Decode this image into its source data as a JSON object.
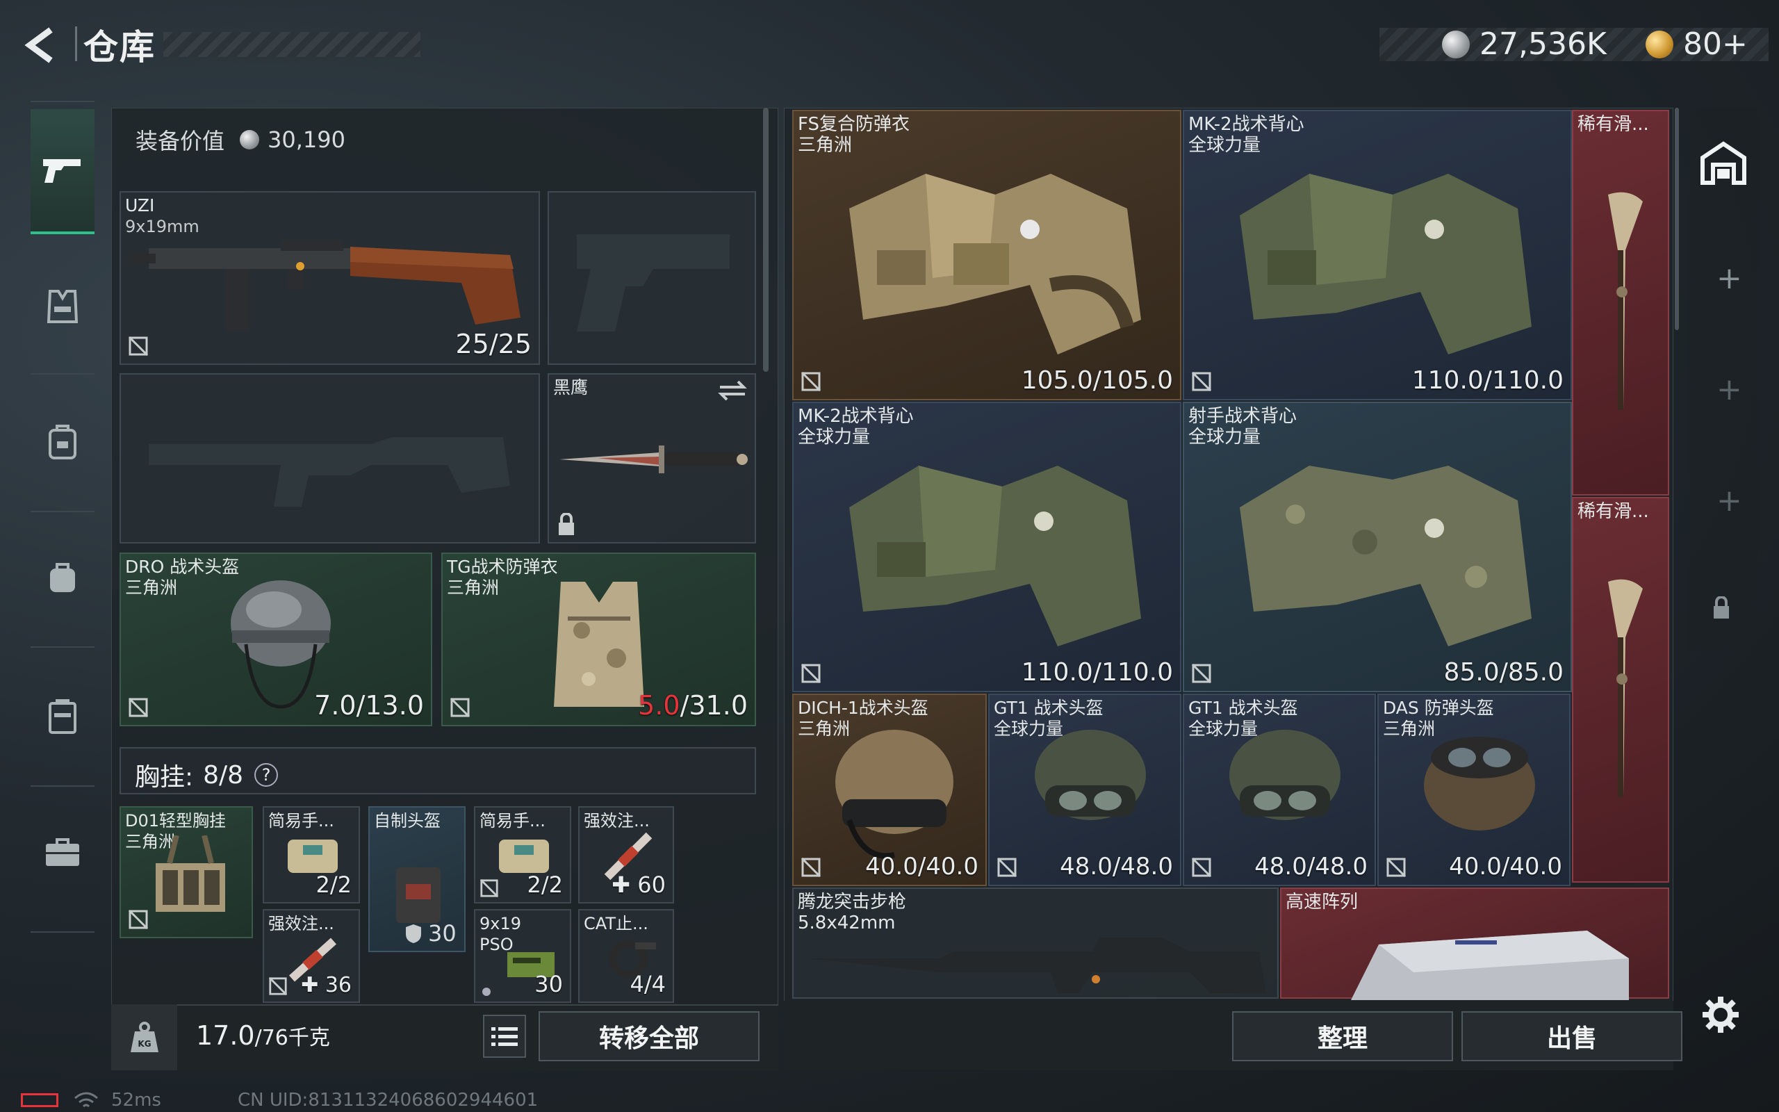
{
  "header": {
    "title": "仓库",
    "currency_silver": "27,536K",
    "currency_gold": "80+"
  },
  "loadout": {
    "equipment_value_label": "装备价值",
    "equipment_value": "30,190",
    "primary": {
      "name": "UZI",
      "caliber": "9x19mm",
      "ammo": "25/25"
    },
    "melee": {
      "name": "黑鹰"
    },
    "helmet": {
      "name": "DRO 战术头盔",
      "region": "三角洲",
      "dur_current": "7.0",
      "dur_max": "/13.0"
    },
    "armor": {
      "name": "TG战术防弹衣",
      "region": "三角洲",
      "dur_current": "5.0",
      "dur_max": "/31.0"
    },
    "chest_rig": {
      "label": "胸挂:",
      "capacity": "8/8",
      "help": "?"
    },
    "rig_items": [
      {
        "name": "D01轻型胸挂",
        "sub": "三角洲"
      },
      {
        "name": "简易手...",
        "count": "2/2"
      },
      {
        "name": "自制头盔",
        "value": "30"
      },
      {
        "name": "简易手...",
        "count": "2/2"
      },
      {
        "name": "强效注...",
        "value": "60"
      },
      {
        "name": "强效注...",
        "value": "36"
      },
      {
        "name": "9x19",
        "sub": "PSO",
        "value": "30"
      },
      {
        "name": "CAT止...",
        "count": "4/4"
      }
    ],
    "weight": {
      "current": "17.0",
      "max": "/76千克"
    },
    "transfer_all": "转移全部"
  },
  "storage": {
    "items": [
      {
        "name": "FS复合防弹衣",
        "sub": "三角洲",
        "dur": "105.0/105.0"
      },
      {
        "name": "MK-2战术背心",
        "sub": "全球力量",
        "dur": "110.0/110.0"
      },
      {
        "name": "稀有滑..."
      },
      {
        "name": "MK-2战术背心",
        "sub": "全球力量",
        "dur": "110.0/110.0"
      },
      {
        "name": "射手战术背心",
        "sub": "全球力量",
        "dur": "85.0/85.0"
      },
      {
        "name": "稀有滑..."
      },
      {
        "name": "DICH-1战术头盔",
        "sub": "三角洲",
        "dur": "40.0/40.0"
      },
      {
        "name": "GT1 战术头盔",
        "sub": "全球力量",
        "dur": "48.0/48.0"
      },
      {
        "name": "GT1 战术头盔",
        "sub": "全球力量",
        "dur": "48.0/48.0"
      },
      {
        "name": "DAS 防弹头盔",
        "sub": "三角洲",
        "dur": "40.0/40.0"
      },
      {
        "name": "腾龙突击步枪",
        "sub": "5.8x42mm"
      },
      {
        "name": "高速阵列"
      }
    ],
    "sort": "整理",
    "sell": "出售"
  },
  "status": {
    "ping": "52ms",
    "uid": "CN UID:8131132406860294460​1"
  },
  "colors": {
    "warn": "#e8333a",
    "accent_green": "#2fbf8a"
  }
}
